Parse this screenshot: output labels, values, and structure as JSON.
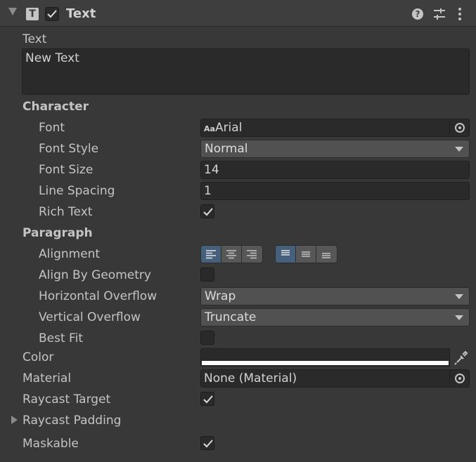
{
  "header": {
    "title": "Text",
    "component_icon_letter": "T",
    "enabled": true,
    "icons": [
      "help-icon",
      "preset-icon",
      "context-menu-icon"
    ]
  },
  "text": {
    "label": "Text",
    "value": "New Text"
  },
  "character": {
    "section_label": "Character",
    "font": {
      "label": "Font",
      "value": "Arial",
      "icon_text": "Aa"
    },
    "font_style": {
      "label": "Font Style",
      "value": "Normal"
    },
    "font_size": {
      "label": "Font Size",
      "value": "14"
    },
    "line_spacing": {
      "label": "Line Spacing",
      "value": "1"
    },
    "rich_text": {
      "label": "Rich Text",
      "checked": true
    }
  },
  "paragraph": {
    "section_label": "Paragraph",
    "alignment": {
      "label": "Alignment",
      "horizontal": [
        "left",
        "center",
        "right"
      ],
      "horizontal_selected": "left",
      "vertical": [
        "top",
        "middle",
        "bottom"
      ],
      "vertical_selected": "top"
    },
    "align_by_geometry": {
      "label": "Align By Geometry",
      "checked": false
    },
    "horizontal_overflow": {
      "label": "Horizontal Overflow",
      "value": "Wrap"
    },
    "vertical_overflow": {
      "label": "Vertical Overflow",
      "value": "Truncate"
    },
    "best_fit": {
      "label": "Best Fit",
      "checked": false
    }
  },
  "color": {
    "label": "Color",
    "value": "#ffffff"
  },
  "material": {
    "label": "Material",
    "value": "None (Material)"
  },
  "raycast_target": {
    "label": "Raycast Target",
    "checked": true
  },
  "raycast_padding": {
    "label": "Raycast Padding"
  },
  "maskable": {
    "label": "Maskable",
    "checked": true
  },
  "colors": {
    "panel_bg": "#383838",
    "field_bg": "#2a2a2a",
    "dropdown_bg": "#515151",
    "active_button": "#46607c",
    "text": "#c4c4c4"
  }
}
